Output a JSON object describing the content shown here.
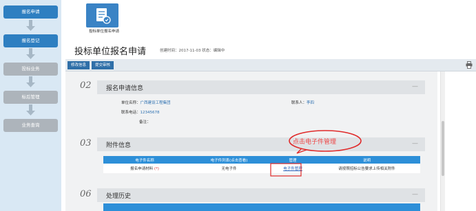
{
  "sidebar": {
    "steps": [
      {
        "label": "报名申请",
        "state": "active"
      },
      {
        "label": "报名登记",
        "state": "active"
      },
      {
        "label": "投标业务",
        "state": "inactive"
      },
      {
        "label": "标后管理",
        "state": "inactive"
      },
      {
        "label": "业务查询",
        "state": "inactive"
      }
    ]
  },
  "top_icon": {
    "label": "投标单位报名申请",
    "icon": "form-document-icon"
  },
  "page": {
    "title": "投标单位报名申请",
    "meta": "创建时间：2017-11-03  状态：编辑中"
  },
  "toolbar": {
    "edit_label": "修改信息",
    "submit_label": "提交审核",
    "print_icon": "printer-icon"
  },
  "sections": {
    "apply": {
      "num": "02",
      "title": "报名申请信息",
      "collapse": "—",
      "unit_name_label": "单位名称：",
      "unit_name_value": "广西建设工程集团",
      "contact_label": "联系人：",
      "contact_value": "李四",
      "phone_label": "联系电话：",
      "phone_value": "12345678",
      "remark_label": "备注："
    },
    "attach": {
      "num": "03",
      "title": "附件信息",
      "collapse": "—",
      "columns": [
        "电子件名称",
        "电子件列表(点击查看)",
        "管理",
        "说明"
      ],
      "row": {
        "name": "报名申请材料",
        "required_mark": "(*)",
        "list": "无电子件",
        "manage": "电子件管理",
        "desc": "请按照招标公告要求上传相关附件"
      }
    },
    "history": {
      "num": "06",
      "title": "处理历史",
      "collapse": "—"
    }
  },
  "annotation": {
    "text": "点击电子件管理",
    "color": "#e02a2a"
  },
  "colors": {
    "primary": "#2e7fc1",
    "table_header": "#2d8fd8",
    "step_inactive": "#adb4bb"
  }
}
